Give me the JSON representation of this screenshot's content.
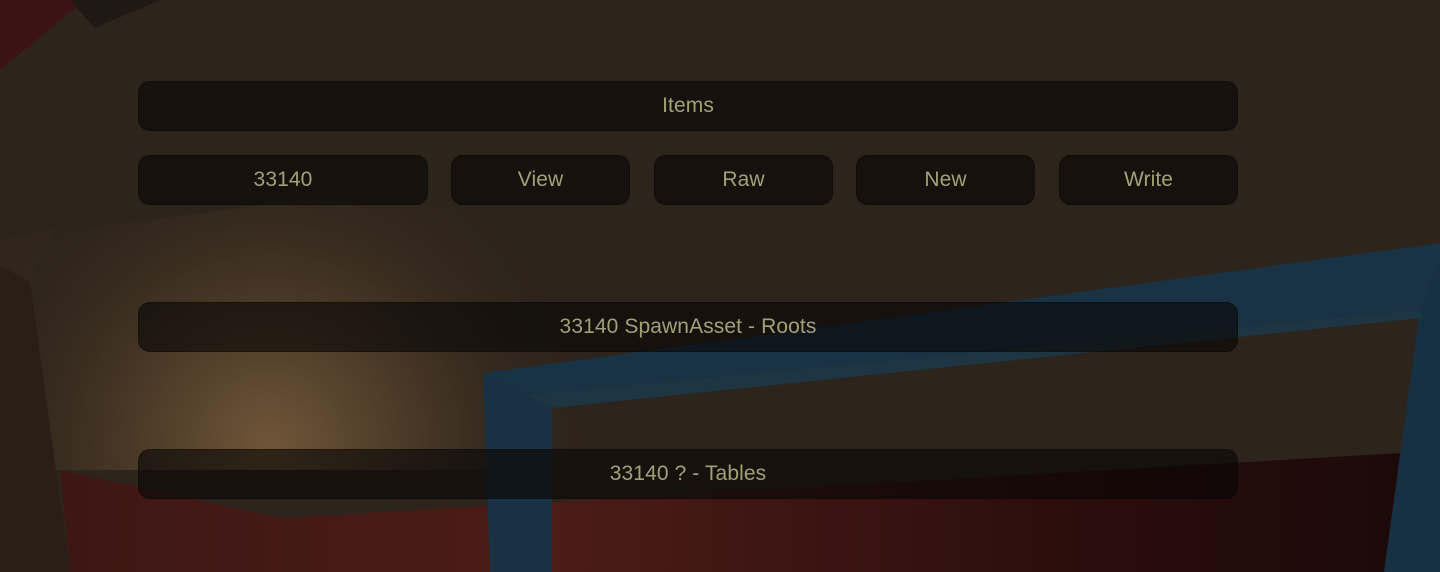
{
  "header": {
    "title": "Items"
  },
  "toolbar": {
    "id_field_value": "33140",
    "view_label": "View",
    "raw_label": "Raw",
    "new_label": "New",
    "write_label": "Write"
  },
  "entries": [
    {
      "label": "33140 SpawnAsset - Roots"
    },
    {
      "label": "33140 ? - Tables"
    }
  ],
  "colors": {
    "text": "#a3a078",
    "panel": "#0a0806",
    "wall": "#2e241b",
    "floor": "#4a1a17",
    "beam": "#1a3442"
  }
}
